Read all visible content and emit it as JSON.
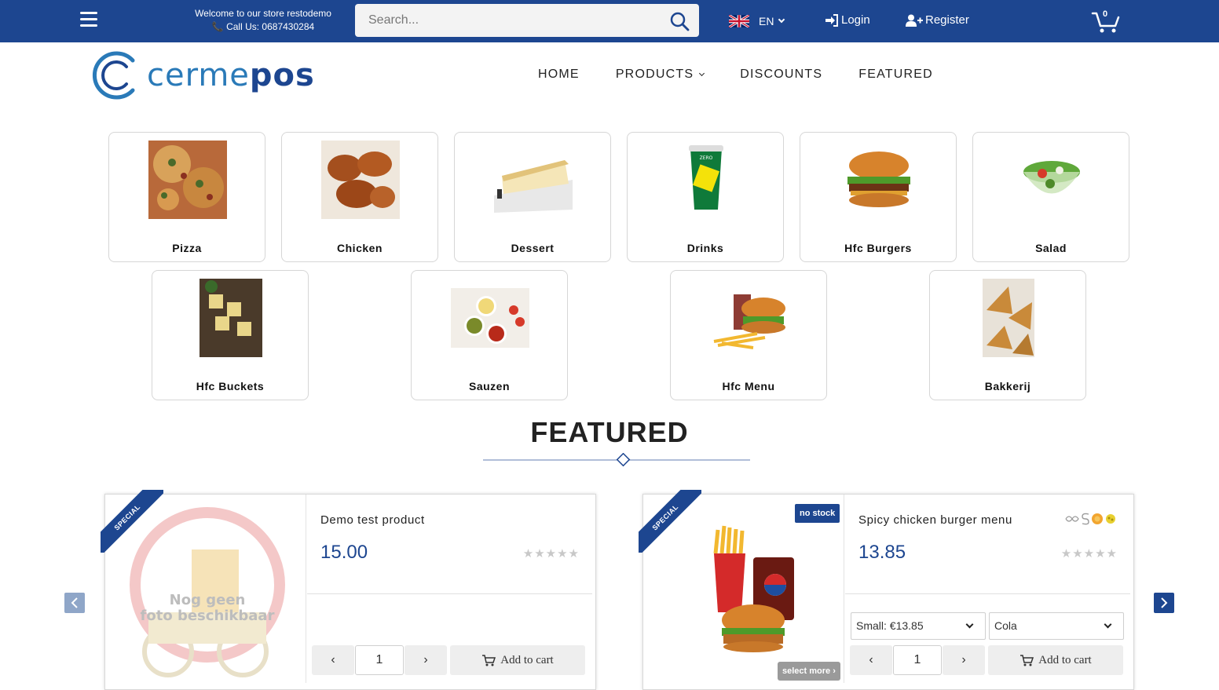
{
  "topbar": {
    "welcome_line1": "Welcome to our store restodemo",
    "welcome_line2": "📞 Call Us: 0687430284",
    "search_placeholder": "Search...",
    "language": "EN",
    "login_label": "Login",
    "register_label": "Register",
    "cart_count": "0"
  },
  "brand": {
    "logo_light": "cerme",
    "logo_bold": "pos"
  },
  "nav": {
    "home": "HOME",
    "products": "PRODUCTS",
    "discounts": "DISCOUNTS",
    "featured": "FEATURED"
  },
  "categories": [
    {
      "label": "Pizza"
    },
    {
      "label": "Chicken"
    },
    {
      "label": "Dessert"
    },
    {
      "label": "Drinks"
    },
    {
      "label": "Hfc Burgers"
    },
    {
      "label": "Salad"
    },
    {
      "label": "Hfc Buckets"
    },
    {
      "label": "Sauzen"
    },
    {
      "label": "Hfc Menu"
    },
    {
      "label": "Bakkerij"
    }
  ],
  "featured": {
    "title": "FEATURED"
  },
  "products": [
    {
      "ribbon": "SPECIAL",
      "name": "Demo test product",
      "price": "15.00",
      "stars": "★★★★★",
      "placeholder_line1": "Nog geen",
      "placeholder_line2": "foto beschikbaar",
      "qty": "1",
      "add_to_cart": "Add to cart"
    },
    {
      "ribbon": "SPECIAL",
      "badge": "no stock",
      "name": "Spicy chicken burger menu",
      "price": "13.85",
      "stars": "★★★★★",
      "size_option": "Small: €13.85",
      "drink_option": "Cola",
      "select_more": "select more ›",
      "qty": "1",
      "add_to_cart": "Add to cart"
    }
  ],
  "colors": {
    "brand_blue": "#1d4690",
    "logo_blue": "#2a7ab8"
  }
}
